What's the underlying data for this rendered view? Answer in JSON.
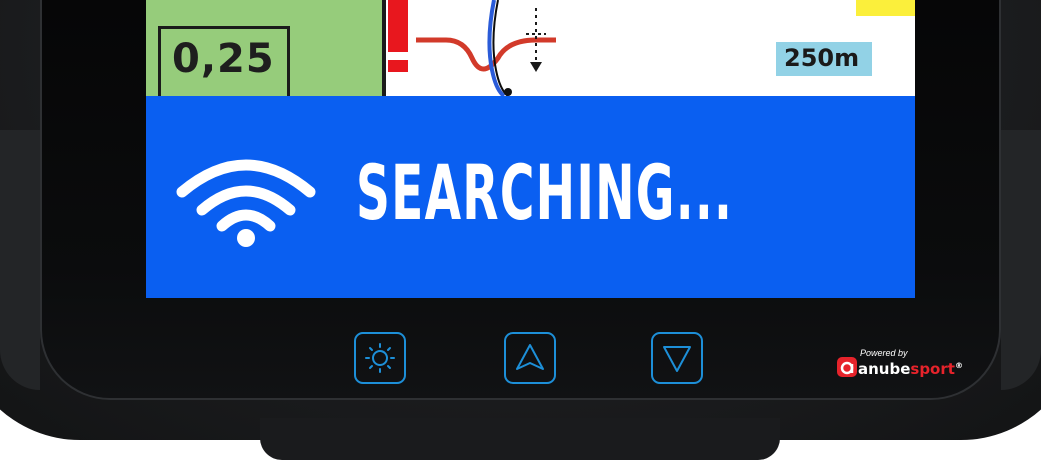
{
  "display": {
    "metric_value": "0,25",
    "distance_label": "250m",
    "colors": {
      "metric_tile": "#96cc7b",
      "distance_chip": "#92d2e6",
      "warning": "#e8171e",
      "route": "#2a5bd8",
      "curve": "#d23a2a",
      "highlight": "#fbef3b"
    }
  },
  "banner": {
    "status_text": "SEARCHING...",
    "icon": "wifi-icon",
    "color": "#0a5ff1"
  },
  "hardware_buttons": [
    {
      "icon": "brightness-icon"
    },
    {
      "icon": "arrow-up-icon"
    },
    {
      "icon": "arrow-down-icon"
    }
  ],
  "brand": {
    "powered_by": "Powered by",
    "name_part1": "anube",
    "name_part2": "sport",
    "registered": "®",
    "accent_color": "#e6232b"
  },
  "accent_color": "#1d8fd8"
}
